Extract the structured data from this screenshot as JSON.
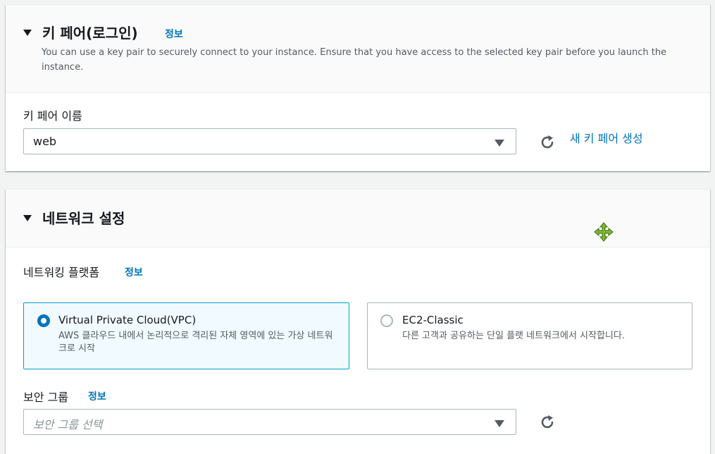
{
  "keypair_section": {
    "title": "키 페어(로그인)",
    "info_label": "정보",
    "description": "You can use a key pair to securely connect to your instance. Ensure that you have access to the selected key pair before you launch the instance.",
    "field_label": "키 페어 이름",
    "selected_value": "web",
    "new_keypair_link": "새 키 페어 생성"
  },
  "network_section": {
    "title": "네트워크 설정",
    "platform_label": "네트워킹 플랫폼",
    "platform_info_label": "정보",
    "options": [
      {
        "title": "Virtual Private Cloud(VPC)",
        "description": "AWS 클라우드 내에서 논리적으로 격리된 자체 영역에 있는 가상 네트워크로 시작",
        "selected": true
      },
      {
        "title": "EC2-Classic",
        "description": "다른 고객과 공유하는 단일 플랫 네트워크에서 시작합니다.",
        "selected": false
      }
    ],
    "security_group_label": "보안 그룹",
    "security_group_info_label": "정보",
    "security_group_placeholder": "보안 그룹 선택"
  },
  "colors": {
    "link": "#0073bb",
    "selected_tile_border": "#00a1c9",
    "selected_tile_bg": "#f1faff",
    "move_icon": "#7cb82f"
  },
  "icons": [
    "caret-down-icon",
    "refresh-icon",
    "move-cursor-icon",
    "radio-checked",
    "radio-unchecked"
  ]
}
